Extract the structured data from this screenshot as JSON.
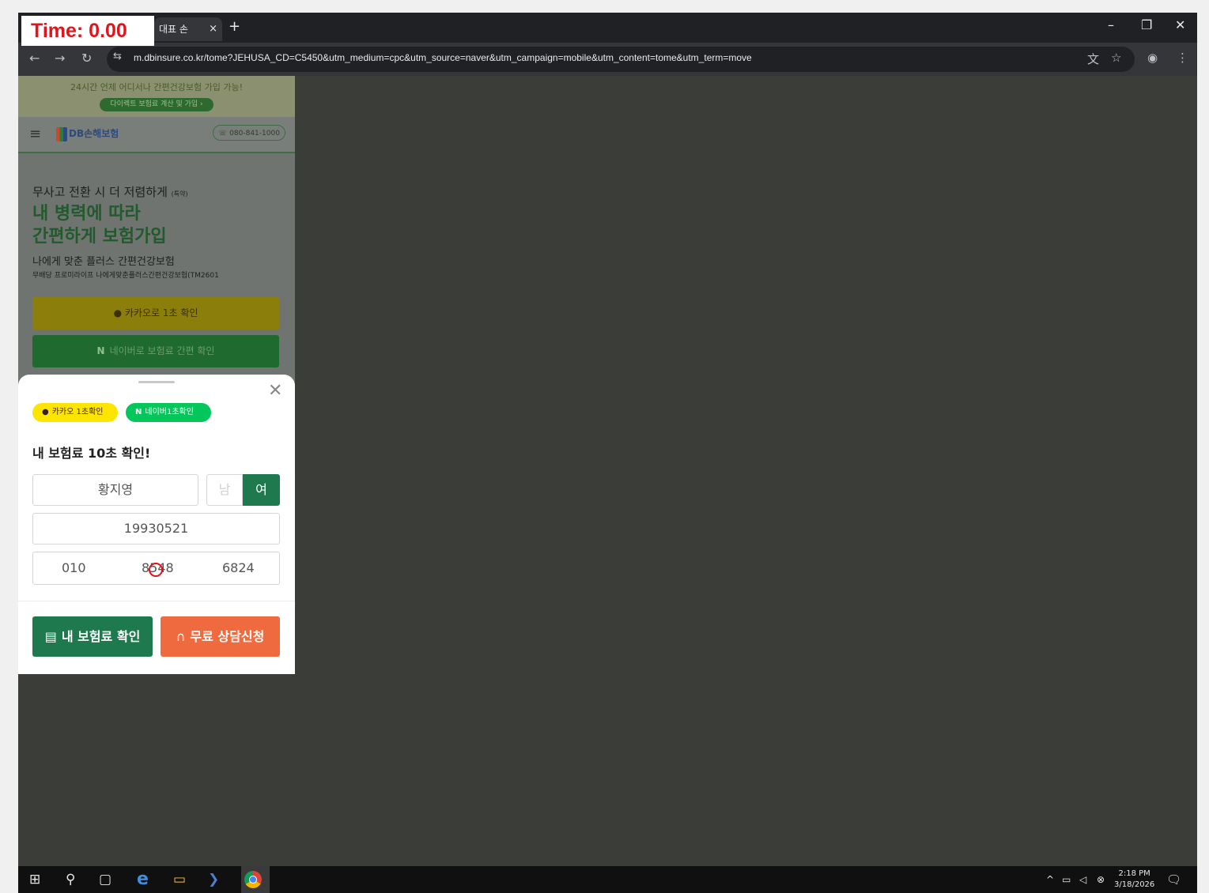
{
  "timer": {
    "label": "Time: 0.00"
  },
  "browser": {
    "tab": {
      "title": "대표 손",
      "close_glyph": "×"
    },
    "new_tab_glyph": "+",
    "window_controls": {
      "minimize": "–",
      "restore": "❐",
      "close": "✕"
    },
    "nav": {
      "back": "←",
      "forward": "→",
      "reload": "↻"
    },
    "site_info_glyph": "⇆",
    "url": "m.dbinsure.co.kr/tome?JEHUSA_CD=C5450&utm_medium=cpc&utm_source=naver&utm_campaign=mobile&utm_content=tome&utm_term=move",
    "icons": {
      "translate": "⽂",
      "bookmark": "☆",
      "profile": "◉",
      "menu": "⋮"
    }
  },
  "page": {
    "banner": {
      "line1": "24시간 언제 어디서나 간편건강보험 가입 가능!",
      "button": "다이렉트 보험료 계산 및 가입 ›"
    },
    "header": {
      "menu_glyph": "≡",
      "logo": "DB손해보험",
      "phone": "080-841-1000"
    },
    "hero": {
      "pre": "무사고 전환 시 더 저렴하게",
      "pre_note": "(특약)",
      "headline_1": "내 병력에 따라",
      "headline_2": "간편하게 보험가입",
      "sub": "나에게 맞춘 플러스 간편건강보험",
      "fine": "무배당 프로미라이프 나에게맞춘플러스간편건강보험(TM2601"
    },
    "kakao_button": "카카오로 1초 확인",
    "naver_button": {
      "mark": "N",
      "label": "네이버로 보험료 간편 확인"
    }
  },
  "sheet": {
    "close_glyph": "✕",
    "kakao_pill": "카카오 1초확인",
    "naver_pill": {
      "mark": "N",
      "label": "네이버1초확인"
    },
    "title": "내 보험료 10초 확인!",
    "name_value": "황지영",
    "gender_male": "남",
    "gender_female": "여",
    "birth_value": "19930521",
    "phone": {
      "part1": "010",
      "part2": "8548",
      "part3": "6824"
    },
    "cta_premium": "내 보험료 확인",
    "cta_consult": "무료 상담신청"
  },
  "taskbar": {
    "start": "⊞",
    "search": "⚲",
    "task_view": "▢",
    "edge": "e",
    "explorer": "▭",
    "powershell": "❯",
    "tray_chevron": "^",
    "time": "2:18 PM",
    "date": "3/18/2026",
    "notification": "🗨"
  },
  "colors": {
    "accent_green": "#1e7a4e",
    "consult_orange": "#f06a40",
    "kakao_yellow": "#fee500",
    "naver_green": "#03c75a",
    "timer_red": "#e0141b"
  }
}
